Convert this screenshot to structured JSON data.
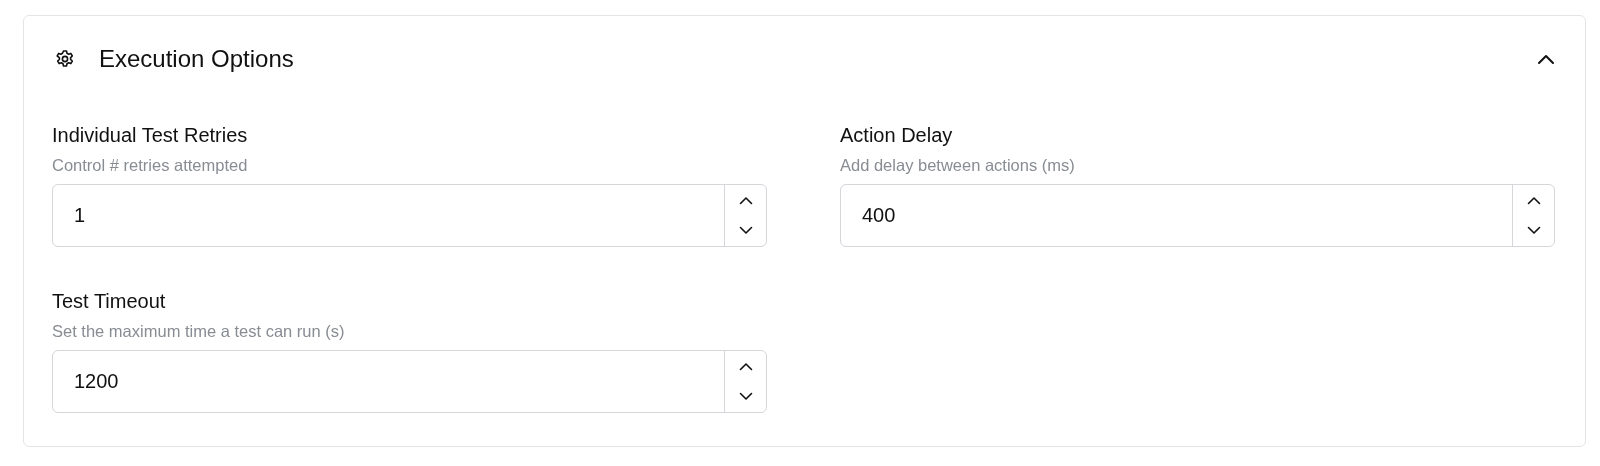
{
  "section": {
    "title": "Execution Options",
    "expanded": true
  },
  "fields": [
    {
      "label": "Individual Test Retries",
      "description": "Control # retries attempted",
      "value": "1"
    },
    {
      "label": "Action Delay",
      "description": "Add delay between actions (ms)",
      "value": "400"
    },
    {
      "label": "Test Timeout",
      "description": "Set the maximum time a test can run (s)",
      "value": "1200"
    }
  ]
}
